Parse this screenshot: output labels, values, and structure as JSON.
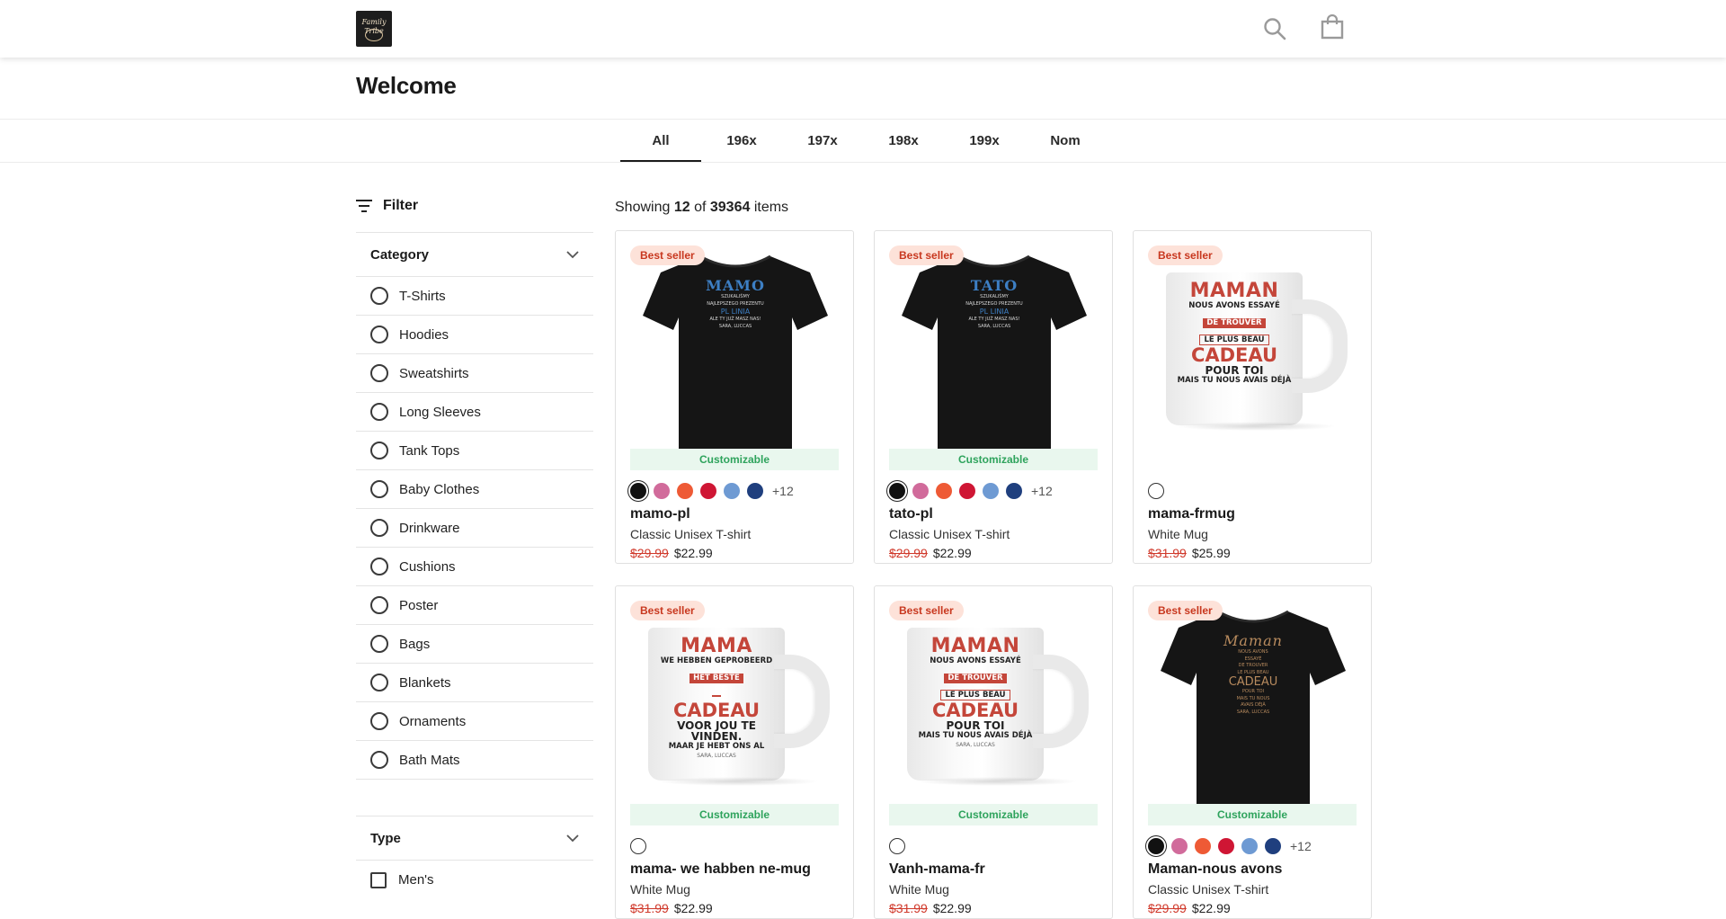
{
  "header": {
    "logo_line1": "Family",
    "logo_line2": "Tribe"
  },
  "page_title": "Welcome",
  "tabs": [
    {
      "label": "All",
      "active": true
    },
    {
      "label": "196x",
      "active": false
    },
    {
      "label": "197x",
      "active": false
    },
    {
      "label": "198x",
      "active": false
    },
    {
      "label": "199x",
      "active": false
    },
    {
      "label": "Nom",
      "active": false
    }
  ],
  "filter": {
    "title": "Filter",
    "category": {
      "title": "Category",
      "options": [
        "T-Shirts",
        "Hoodies",
        "Sweatshirts",
        "Long Sleeves",
        "Tank Tops",
        "Baby Clothes",
        "Drinkware",
        "Cushions",
        "Poster",
        "Bags",
        "Blankets",
        "Ornaments",
        "Bath Mats"
      ]
    },
    "type": {
      "title": "Type",
      "options": [
        "Men's"
      ]
    }
  },
  "results": {
    "prefix": "Showing",
    "shown": "12",
    "of": "of",
    "total": "39364",
    "suffix": "items"
  },
  "products": [
    {
      "name": "mamo-pl",
      "type": "Classic Unisex T-shirt",
      "old_price": "$29.99",
      "price": "$22.99",
      "badge": "Best seller",
      "customizable": "Customizable",
      "image": "shirt",
      "print_title": "MAMO",
      "print_lines": [
        "SZUKALIŚMY",
        "NAJLEPSZEGO PREZENTU",
        "PL LINIA",
        "ALE TY JUŻ MASZ NAS!",
        "SARA, LUCCAS"
      ],
      "colors": [
        "#111111",
        "#d16b9b",
        "#ee5a35",
        "#cf1634",
        "#6e9ad3",
        "#1f3f7e"
      ],
      "more": "+12"
    },
    {
      "name": "tato-pl",
      "type": "Classic Unisex T-shirt",
      "old_price": "$29.99",
      "price": "$22.99",
      "badge": "Best seller",
      "customizable": "Customizable",
      "image": "shirt",
      "print_title": "TATO",
      "print_lines": [
        "SZUKALIŚMY",
        "NAJLEPSZEGO PREZENTU",
        "PL LINIA",
        "ALE TY JUŻ MASZ NAS!",
        "SARA, LUCCAS"
      ],
      "colors": [
        "#111111",
        "#d16b9b",
        "#ee5a35",
        "#cf1634",
        "#6e9ad3",
        "#1f3f7e"
      ],
      "more": "+12"
    },
    {
      "name": "mama-frmug",
      "type": "White Mug",
      "old_price": "$31.99",
      "price": "$25.99",
      "badge": "Best seller",
      "customizable": "",
      "image": "mug",
      "print_title": "MAMAN",
      "print_lines": [
        "NOUS AVONS ESSAYÉ",
        "DE TROUVER",
        "LE PLUS BEAU",
        "CADEAU",
        "POUR TOI",
        "MAIS TU NOUS AVAIS DÉJÀ",
        ""
      ],
      "colors": [
        "#ffffff"
      ],
      "more": ""
    },
    {
      "name": "mama- we habben ne-mug",
      "type": "White Mug",
      "old_price": "$31.99",
      "price": "$22.99",
      "badge": "Best seller",
      "customizable": "Customizable",
      "image": "mug",
      "print_title": "MAMA",
      "print_lines": [
        "WE HEBBEN GEPROBEERD",
        "HET BESTE",
        "",
        "CADEAU",
        "VOOR JOU TE VINDEN.",
        "MAAR JE HEBT ONS AL",
        "SARA, LUCCAS"
      ],
      "colors": [
        "#ffffff"
      ],
      "more": ""
    },
    {
      "name": "Vanh-mama-fr",
      "type": "White Mug",
      "old_price": "$31.99",
      "price": "$22.99",
      "badge": "Best seller",
      "customizable": "Customizable",
      "image": "mug",
      "print_title": "MAMAN",
      "print_lines": [
        "NOUS AVONS ESSAYÉ",
        "DE TROUVER",
        "LE PLUS BEAU",
        "CADEAU",
        "POUR TOI",
        "MAIS TU NOUS AVAIS DÉJÀ",
        "SARA, LUCCAS"
      ],
      "colors": [
        "#ffffff"
      ],
      "more": ""
    },
    {
      "name": "Maman-nous avons",
      "type": "Classic Unisex T-shirt",
      "old_price": "$29.99",
      "price": "$22.99",
      "badge": "Best seller",
      "customizable": "Customizable",
      "image": "shirt-gold",
      "print_title": "Maman",
      "print_lines": [
        "NOUS AVONS",
        "ESSAYÉ",
        "DE TROUVER",
        "LE PLUS BEAU",
        "CADEAU",
        "POUR TOI",
        "MAIS TU NOUS",
        "AVAIS DÉJÀ",
        "SARA, LUCCAS"
      ],
      "colors": [
        "#111111",
        "#d16b9b",
        "#ee5a35",
        "#cf1634",
        "#6e9ad3",
        "#1f3f7e"
      ],
      "more": "+12"
    }
  ]
}
